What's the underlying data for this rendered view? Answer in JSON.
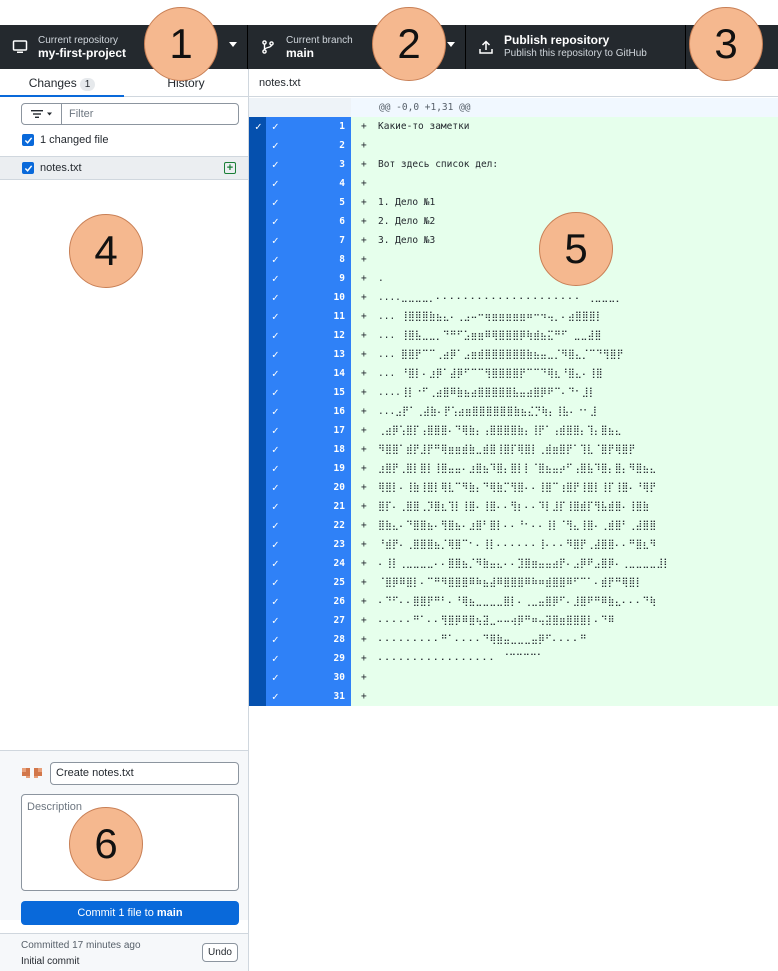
{
  "toolbar": {
    "repo": {
      "label": "Current repository",
      "value": "my-first-project"
    },
    "branch": {
      "label": "Current branch",
      "value": "main"
    },
    "publish": {
      "title": "Publish repository",
      "subtitle": "Publish this repository to GitHub"
    }
  },
  "callouts": [
    "1",
    "2",
    "3",
    "4",
    "5",
    "6"
  ],
  "sidebar": {
    "tabs": [
      {
        "label": "Changes",
        "count": "1"
      },
      {
        "label": "History"
      }
    ],
    "filter_placeholder": "Filter",
    "changed_files_label": "1 changed file",
    "files": [
      {
        "name": "notes.txt",
        "status": "added"
      }
    ]
  },
  "commit": {
    "summary_placeholder": "Create notes.txt",
    "description_placeholder": "Description",
    "button_prefix": "Commit 1 file to ",
    "button_branch": "main"
  },
  "last_commit": {
    "time": "Committed 17 minutes ago",
    "message": "Initial commit",
    "undo_label": "Undo"
  },
  "diff": {
    "filename": "notes.txt",
    "hunk_header": "@@ -0,0 +1,31 @@",
    "lines": [
      {
        "n": "1",
        "text": "Какие-то заметки"
      },
      {
        "n": "2",
        "text": ""
      },
      {
        "n": "3",
        "text": "Вот здесь список дел:"
      },
      {
        "n": "4",
        "text": ""
      },
      {
        "n": "5",
        "text": "1. Дело №1"
      },
      {
        "n": "6",
        "text": "2. Дело №2"
      },
      {
        "n": "7",
        "text": "3. Дело №3"
      },
      {
        "n": "8",
        "text": ""
      },
      {
        "n": "9",
        "text": "."
      },
      {
        "n": "10",
        "text": "....⣀⣀⣀⣀⡀⠄⠄⠄⠄⠄⠄⠄⠄⠄⠄⠄⠄⠄⠄⠄⠄⠄⠄⠄⠄⠄ ⢀⣀⣀⣀⡀"
      },
      {
        "n": "11",
        "text": "... ⢸⣿⣿⣿⣷⣦⣄⠄⢀⣠⠤⠒⢶⣶⣶⣶⣶⣶⠶⠒⠲⢤⡀⠄⣴⣿⣿⣿⡇"
      },
      {
        "n": "12",
        "text": "... ⢸⣿⣧⣀⣀⡀⠙⠛⠋⣡⣶⣶⠿⢿⣿⣿⣿⡿⢷⣾⣦⣍⠛⠋ ⣀⣀⣼⣿"
      },
      {
        "n": "13",
        "text": "... ⣿⣿⡟⠉⠉⢀⣴⡿⠁⣠⣶⣾⣿⣿⣿⣿⣿⣿⣷⣦⣤⣀⡈⠻⣿⣄⡈⠉⠙⢻⣿⡟"
      },
      {
        "n": "14",
        "text": "... ⠘⣿⡇⠄⣰⡿⠁⣼⡿⠋⠉⠉⢻⣿⣿⣿⣿⡟⠉⠉⠙⢿⣆⠘⣿⣄⠄⢸⣿"
      },
      {
        "n": "15",
        "text": "....⢸⡇⠐⠋⢀⣴⣿⠿⣷⣦⣴⣿⣿⣿⣿⣿⣧⣤⣴⣿⡿⠟⠉⠄⠙⠂⣸⡇"
      },
      {
        "n": "16",
        "text": "...⣠⡟⠁⢀⣼⣷⠄⡟⢡⣴⣶⣿⣿⣿⣿⣿⣿⣷⣦⣌⡙⢷⡄⢸⣧⠄⠐⠂⣸"
      },
      {
        "n": "17",
        "text": "⢀⣴⡿⢡⣿⡏⢠⣿⣿⣿⠄⠙⢿⣷⡄⢠⣿⣿⣿⣿⣷⡄⢸⡟⠁⢠⣾⣿⣿⡄⢹⡄⣿⣦⣄"
      },
      {
        "n": "18",
        "text": "⠻⣿⣿⠁⣾⡟⣸⡟⠛⢿⣶⣶⣾⣷⣀⣾⣿⢸⣿⡏⢿⣿⡇⢀⣾⣶⣿⡟⠁⢹⣇⠈⣿⡟⢿⣿⡟"
      },
      {
        "n": "19",
        "text": "⣰⣿⡟⢀⣿⡇⣿⡇⢸⣿⣤⣤⠄⣰⣿⣦⠹⣿⡄⣿⡇⡇⠈⣿⣦⣤⡴⠋⢠⣿⣧⠹⣿⡄⣿⡄⠻⣿⣦⣄"
      },
      {
        "n": "20",
        "text": "⢿⣿⡇⠄⢸⣷⢸⣿⡇⢿⣇⠉⠻⣷⡄⠙⢿⣷⡉⢻⣿⠄⠄⢸⣿⠉⢰⣿⡟⢸⣿⡇⢸⡏⢸⣿⠄⠘⢿⡟"
      },
      {
        "n": "21",
        "text": "⣿⡏⠄⢀⣿⣿⢀⡹⣿⣆⢹⡇⢸⣿⠄⢸⣿⠄⠄⢻⡆⠄⠄⠹⡇⣸⡏⢸⣿⣾⡏⢻⣧⣾⣿⠄⢸⣿⣷"
      },
      {
        "n": "22",
        "text": "⣿⣷⣄⠄⠙⣿⣿⣦⠄⢻⣿⣦⠄⣰⣿⠃⣿⡇⠄⠄⠘⠂⠄⠄⢸⡇⠈⢻⣄⢸⣿⠄⢀⣾⣿⠃⢀⣼⣿⣿"
      },
      {
        "n": "23",
        "text": "⠘⣾⡟⠄⢀⣿⣿⣿⣦⡈⢿⣿⠉⠂⠄⢸⡇⠄⠄⠄⠄⠄⠄⢸⠄⠄⠄⠻⣿⡟⢀⣼⣿⣿⠄⠄⠛⣿⣆⠻"
      },
      {
        "n": "24",
        "text": "⠄⢸⡇⢀⣀⣀⣀⣀⠄⠄⣿⣿⣦⡈⠻⣷⣤⣄⠄⠄⣹⣿⣶⣤⣤⣴⡟⠄⣠⡿⠟⣠⣿⡿⠄⢀⣀⣀⣀⣀⣸⡇"
      },
      {
        "n": "25",
        "text": "⠈⣿⡿⠿⣿⡇⠄⠉⠛⠻⣿⣿⣿⠿⠷⣦⣼⠿⣿⣿⣿⠿⠷⠶⣾⣿⣿⠿⠋⠉⠁⠄⣾⡟⠛⢿⣿⡇"
      },
      {
        "n": "26",
        "text": "⠄⠙⠋⠄⠄⣿⣿⡟⠛⠃⠄⠘⢿⣦⣀⣀⣀⣀⣿⡇⠄⢀⣀⣤⣿⡿⠋⠄⣸⣿⠟⠛⠿⣷⣄⠄⠄⠄⠙⢷"
      },
      {
        "n": "27",
        "text": "⠄⠄⠄⠄⠄⠛⠁⠄⠄⢻⣿⡿⠿⣿⢦⣽⣀⠤⠤⢴⡿⠛⠶⢤⣽⣿⣶⣿⣿⣿⡇⠄⠙⠿"
      },
      {
        "n": "28",
        "text": "⠄⠄⠄⠄⠄⠄⠄⠄⠄⠛⠁⠄⠄⠄⠄⠙⢿⣷⣤⣀⣀⣀⣤⡿⠋⠄⠄⠄⠄⠛"
      },
      {
        "n": "29",
        "text": "⠄⠄⠄⠄⠄⠄⠄⠄⠄⠄⠄⠄⠄⠄⠄⠄⠄ ⠈⠉⠉⠉⠉⠁"
      },
      {
        "n": "30",
        "text": ""
      },
      {
        "n": "31",
        "text": ""
      }
    ]
  }
}
